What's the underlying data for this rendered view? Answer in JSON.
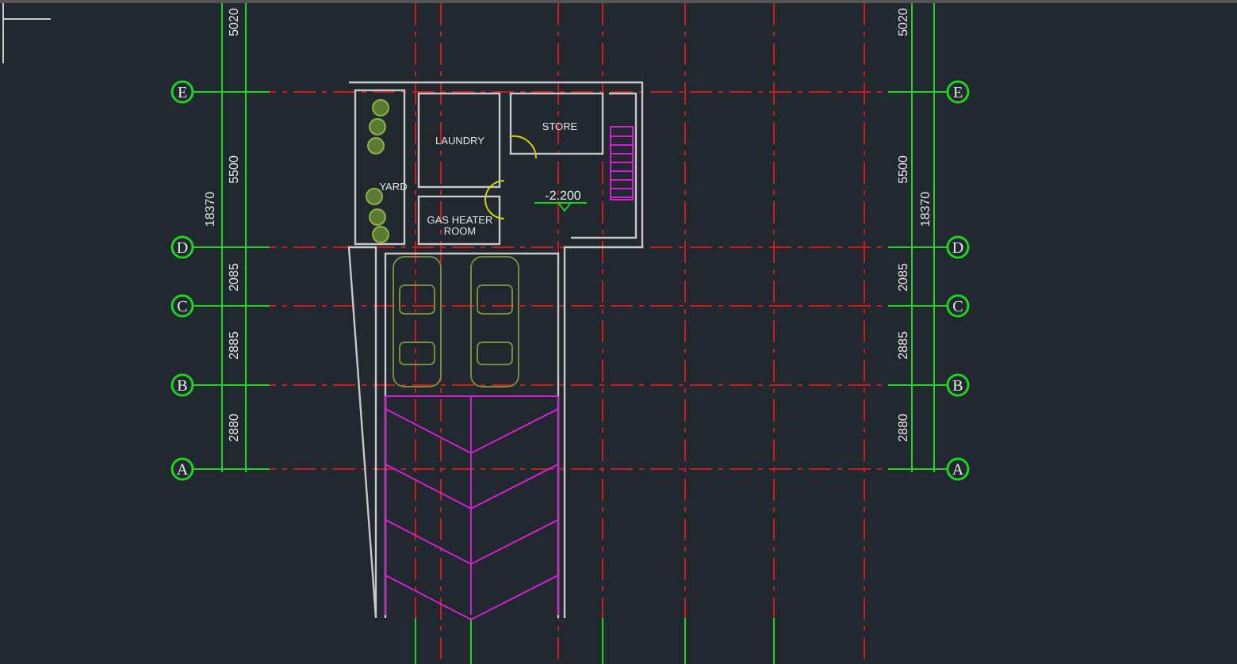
{
  "grid_axes_left": [
    {
      "label": "E"
    },
    {
      "label": "D"
    },
    {
      "label": "C"
    },
    {
      "label": "B"
    },
    {
      "label": "A"
    }
  ],
  "grid_axes_right": [
    {
      "label": "E"
    },
    {
      "label": "D"
    },
    {
      "label": "C"
    },
    {
      "label": "B"
    },
    {
      "label": "A"
    }
  ],
  "dimensions_left": {
    "segments": [
      "5020",
      "5500",
      "2085",
      "2885",
      "2880"
    ],
    "total": "18370"
  },
  "dimensions_right": {
    "segments": [
      "5020",
      "5500",
      "2085",
      "2885",
      "2880"
    ],
    "total": "18370"
  },
  "rooms": [
    {
      "name": "LAUNDRY"
    },
    {
      "name": "STORE"
    },
    {
      "name": "YARD"
    },
    {
      "name": "GAS HEATER ROOM"
    }
  ],
  "level_mark": "-2.200"
}
